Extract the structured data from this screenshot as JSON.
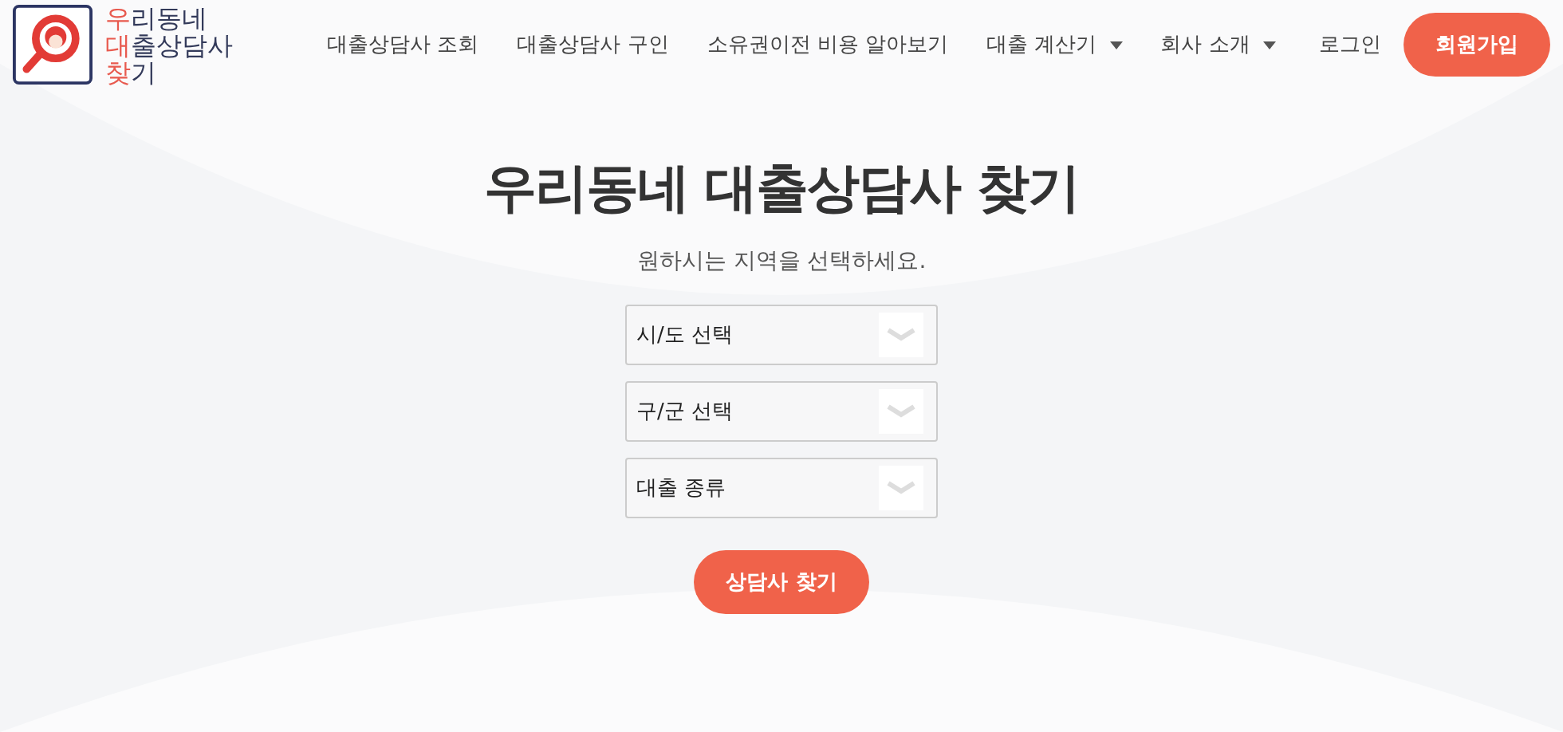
{
  "logo": {
    "lines": [
      {
        "accent": "우",
        "rest": "리동네"
      },
      {
        "accent": "대",
        "rest": "출상담사"
      },
      {
        "accent": "찾",
        "rest": "기"
      }
    ]
  },
  "nav": [
    {
      "label": "대출상담사 조회",
      "kind": "link"
    },
    {
      "label": "대출상담사 구인",
      "kind": "link"
    },
    {
      "label": "소유권이전 비용 알아보기",
      "kind": "link"
    },
    {
      "label": "대출 계산기",
      "kind": "dropdown"
    },
    {
      "label": "회사 소개",
      "kind": "dropdown"
    }
  ],
  "login": "로그인",
  "signup": "회원가입",
  "title": "우리동네 대출상담사 찾기",
  "subtitle": "원하시는 지역을 선택하세요.",
  "selects": [
    {
      "value": "시/도 선택"
    },
    {
      "value": "구/군 선택"
    },
    {
      "value": "대출 종류"
    }
  ],
  "search_button": "상담사 찾기"
}
